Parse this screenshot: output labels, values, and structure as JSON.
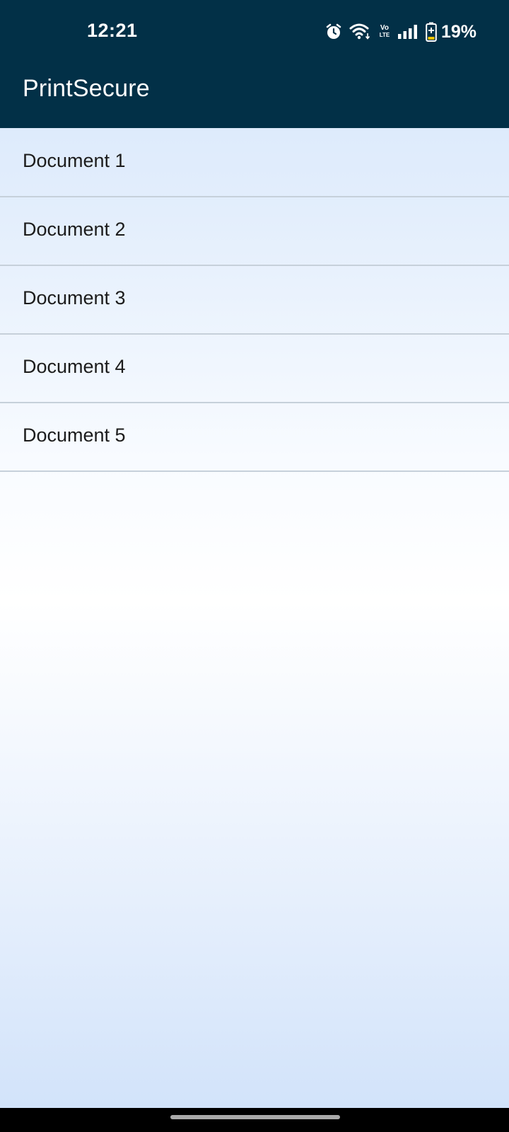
{
  "status_bar": {
    "time": "12:21",
    "icons": [
      "alarm-icon",
      "wifi-icon",
      "volte-icon",
      "signal-icon",
      "battery-icon"
    ],
    "volte_top": "Vo",
    "volte_bottom": "LTE",
    "battery_percent": "19%"
  },
  "app_bar": {
    "title": "PrintSecure",
    "background_color": "#023047"
  },
  "documents": {
    "items": [
      {
        "label": "Document 1"
      },
      {
        "label": "Document 2"
      },
      {
        "label": "Document 3"
      },
      {
        "label": "Document 4"
      },
      {
        "label": "Document 5"
      }
    ]
  }
}
